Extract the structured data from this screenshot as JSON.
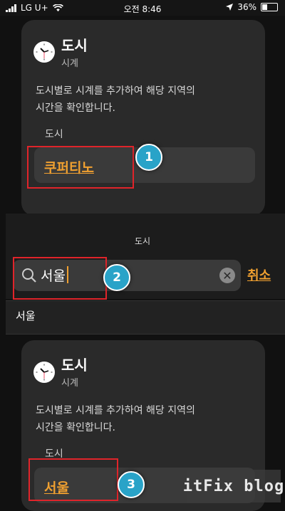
{
  "status_bar": {
    "carrier": "LG U+",
    "time": "오전 8:46",
    "battery": "36%",
    "battery_level": 0.36
  },
  "widget_top": {
    "title": "도시",
    "subtitle": "시계",
    "description_line1": "도시별로 시계를 추가하여 해당 지역의",
    "description_line2": "시간을 확인합니다.",
    "field_label": "도시",
    "city": "쿠퍼티노"
  },
  "search_sheet": {
    "title": "도시",
    "query": "서울",
    "cancel_label": "취소",
    "result": "서울"
  },
  "widget_bottom": {
    "title": "도시",
    "subtitle": "시계",
    "description_line1": "도시별로 시계를 추가하여 해당 지역의",
    "description_line2": "시간을 확인합니다.",
    "field_label": "도시",
    "city": "서울"
  },
  "annotations": {
    "step1": "1",
    "step2": "2",
    "step3": "3"
  },
  "watermark": {
    "prefix": "itFix",
    "suffix": "blog"
  },
  "colors": {
    "accent": "#f0a030",
    "highlight_box": "#e0242a",
    "badge": "#29a3c8",
    "card": "#2a2a2a"
  }
}
